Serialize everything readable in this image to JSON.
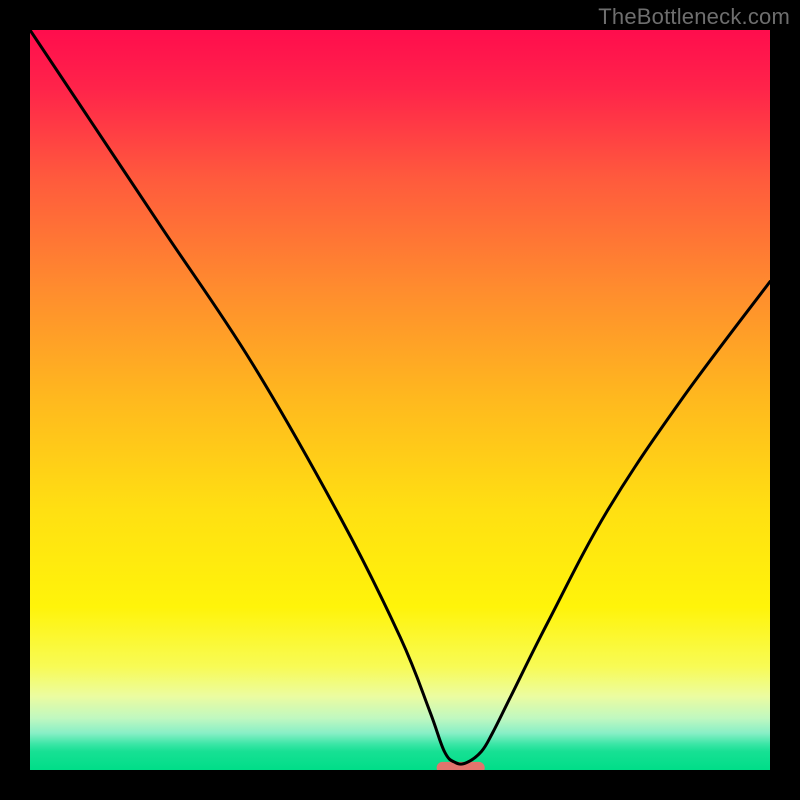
{
  "watermark": "TheBottleneck.com",
  "chart_data": {
    "type": "line",
    "title": "",
    "xlabel": "",
    "ylabel": "",
    "xlim": [
      0,
      100
    ],
    "ylim": [
      0,
      100
    ],
    "grid": false,
    "legend": false,
    "series": [
      {
        "name": "bottleneck_curve",
        "x": [
          0,
          8,
          18,
          30,
          42,
          50,
          54,
          56,
          57.5,
          59,
          61,
          62.5,
          65,
          70,
          78,
          88,
          100
        ],
        "values": [
          100,
          88,
          73,
          55,
          34,
          18,
          8,
          2.5,
          1,
          1,
          2.5,
          5,
          10,
          20,
          35,
          50,
          66
        ]
      }
    ],
    "gradient_stops": [
      {
        "offset": 0.0,
        "color": "#ff0d4d"
      },
      {
        "offset": 0.08,
        "color": "#ff244a"
      },
      {
        "offset": 0.2,
        "color": "#ff5a3d"
      },
      {
        "offset": 0.35,
        "color": "#ff8c2e"
      },
      {
        "offset": 0.5,
        "color": "#ffb91e"
      },
      {
        "offset": 0.65,
        "color": "#ffe012"
      },
      {
        "offset": 0.78,
        "color": "#fff40a"
      },
      {
        "offset": 0.86,
        "color": "#f8fb55"
      },
      {
        "offset": 0.9,
        "color": "#ecfca0"
      },
      {
        "offset": 0.93,
        "color": "#c0f8c0"
      },
      {
        "offset": 0.95,
        "color": "#88efc6"
      },
      {
        "offset": 0.965,
        "color": "#3be6a6"
      },
      {
        "offset": 0.975,
        "color": "#17e094"
      },
      {
        "offset": 1.0,
        "color": "#00de88"
      }
    ],
    "marker": {
      "x": 58.2,
      "y": 0.3,
      "width_pct": 6.5,
      "height_pct": 1.6,
      "color": "#e2746d",
      "rx_pct": 0.8
    }
  }
}
